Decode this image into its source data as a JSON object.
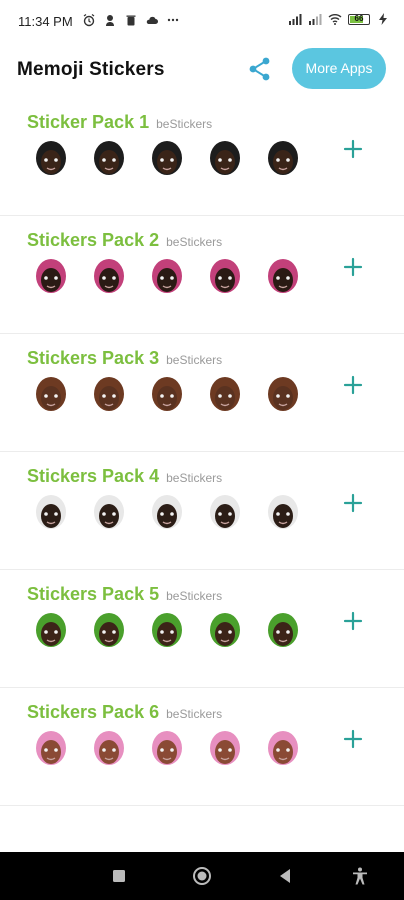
{
  "status": {
    "time": "11:34 PM",
    "battery": "66"
  },
  "appbar": {
    "title": "Memoji Stickers",
    "more_apps_label": "More Apps"
  },
  "packs": [
    {
      "name": "Sticker Pack 1",
      "publisher": "beStickers",
      "head": "#1d1d1d",
      "skin": "#3a2418"
    },
    {
      "name": "Stickers Pack 2",
      "publisher": "beStickers",
      "head": "#c2407a",
      "skin": "#2a1a14"
    },
    {
      "name": "Stickers Pack 3",
      "publisher": "beStickers",
      "head": "#6d3a22",
      "skin": "#5a3220"
    },
    {
      "name": "Stickers Pack 4",
      "publisher": "beStickers",
      "head": "#e8e8e8",
      "skin": "#2b1d16"
    },
    {
      "name": "Stickers Pack 5",
      "publisher": "beStickers",
      "head": "#4aa02c",
      "skin": "#3c2418"
    },
    {
      "name": "Stickers Pack 6",
      "publisher": "beStickers",
      "head": "#e78fc0",
      "skin": "#8a4a35"
    }
  ],
  "colors": {
    "pack_title": "#7cbf3f",
    "add_icon": "#2aa198",
    "more_apps_bg": "#5bc6e0",
    "share_icon": "#3aa7d0"
  }
}
